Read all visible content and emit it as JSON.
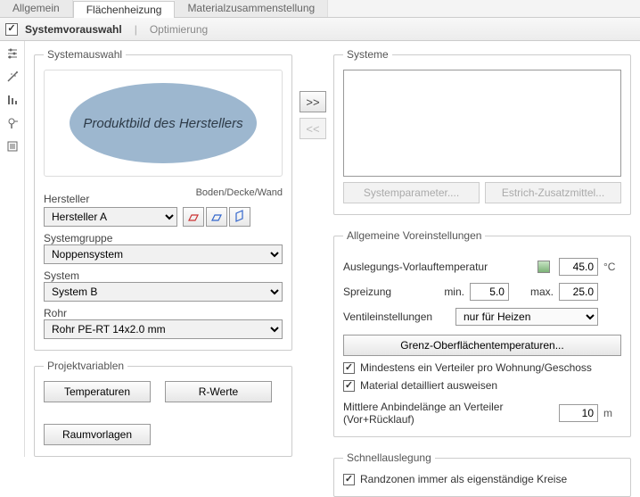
{
  "tabs": {
    "items": [
      {
        "label": "Allgemein"
      },
      {
        "label": "Flächenheizung"
      },
      {
        "label": "Materialzusammenstellung"
      }
    ],
    "activeIndex": 1
  },
  "subheader": {
    "checked": true,
    "title": "Systemvorauswahl",
    "secondary": "Optimierung"
  },
  "sidebarIcons": [
    "sliders-icon",
    "wand-icon",
    "levels-icon",
    "tool-icon",
    "list-icon"
  ],
  "selection": {
    "groupTitle": "Systemauswahl",
    "previewText": "Produktbild des Herstellers",
    "bdwLabel": "Boden/Decke/Wand",
    "herstellerLabel": "Hersteller",
    "hersteller": "Hersteller A",
    "systemgruppeLabel": "Systemgruppe",
    "systemgruppe": "Noppensystem",
    "systemLabel": "System",
    "system": "System B",
    "rohrLabel": "Rohr",
    "rohr": "Rohr PE-RT 14x2.0 mm"
  },
  "projectvars": {
    "title": "Projektvariablen",
    "temperaturen": "Temperaturen",
    "rwerte": "R-Werte",
    "raumvorlagen": "Raumvorlagen"
  },
  "transfer": {
    "add": ">>",
    "remove": "<<"
  },
  "systems": {
    "groupTitle": "Systeme",
    "systemparam": "Systemparameter....",
    "estrich": "Estrich-Zusatzmittel..."
  },
  "settings": {
    "groupTitle": "Allgemeine Voreinstellungen",
    "vorlaufLabel": "Auslegungs-Vorlauftemperatur",
    "vorlauf": "45.0",
    "vorlaufUnit": "°C",
    "spreizungLabel": "Spreizung",
    "minLabel": "min.",
    "min": "5.0",
    "maxLabel": "max.",
    "max": "25.0",
    "ventilLabel": "Ventileinstellungen",
    "ventil": "nur für Heizen",
    "grenzBtn": "Grenz-Oberflächentemperaturen...",
    "chk1": "Mindestens ein Verteiler pro Wohnung/Geschoss",
    "chk1Checked": true,
    "chk2": "Material detailliert ausweisen",
    "chk2Checked": true,
    "anbindLabel": "Mittlere Anbindelänge an Verteiler (Vor+Rücklauf)",
    "anbind": "10",
    "anbindUnit": "m"
  },
  "schnell": {
    "groupTitle": "Schnellauslegung",
    "chk1": "Randzonen immer als eigenständige Kreise",
    "chk1Checked": true
  }
}
